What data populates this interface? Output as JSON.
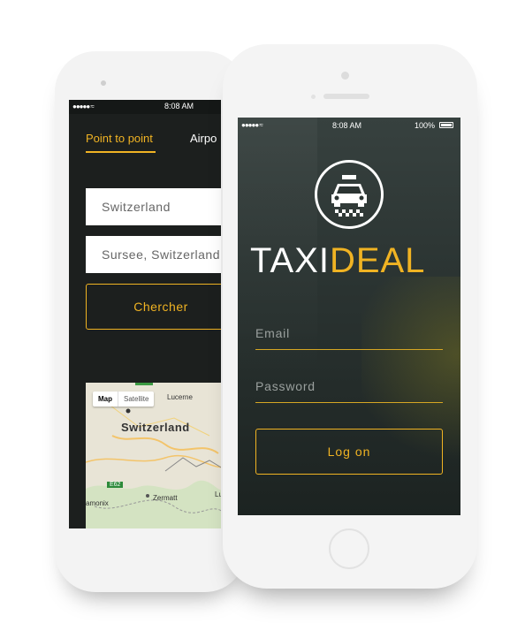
{
  "back_phone": {
    "status": {
      "signal": "●●●●● ≈",
      "time": "8:08 AM"
    },
    "tabs": [
      {
        "label": "Point to point"
      },
      {
        "label": "Airpo"
      }
    ],
    "fields": [
      {
        "value": "Switzerland"
      },
      {
        "value": "Sursee, Switzerland"
      }
    ],
    "search_button": "Chercher",
    "map": {
      "controls": [
        "Map",
        "Satellite"
      ],
      "labels": {
        "country": "Switzerland",
        "lucerne": "Lucerne",
        "zermatt": "Zermatt",
        "road": "E62",
        "amonix": "amonix",
        "lu": "Lu"
      }
    }
  },
  "front_phone": {
    "status": {
      "signal": "●●●●● ≈",
      "time": "8:08 AM",
      "battery": "100%"
    },
    "brand": {
      "part1": "TAXI",
      "part2": "DEAL"
    },
    "logo_icon": "taxi-icon",
    "email_placeholder": "Email",
    "password_placeholder": "Password",
    "login_button": "Log on"
  },
  "colors": {
    "accent": "#f0b323",
    "screen_dark": "#1c1f1e",
    "phone_body": "#f4f4f4"
  }
}
